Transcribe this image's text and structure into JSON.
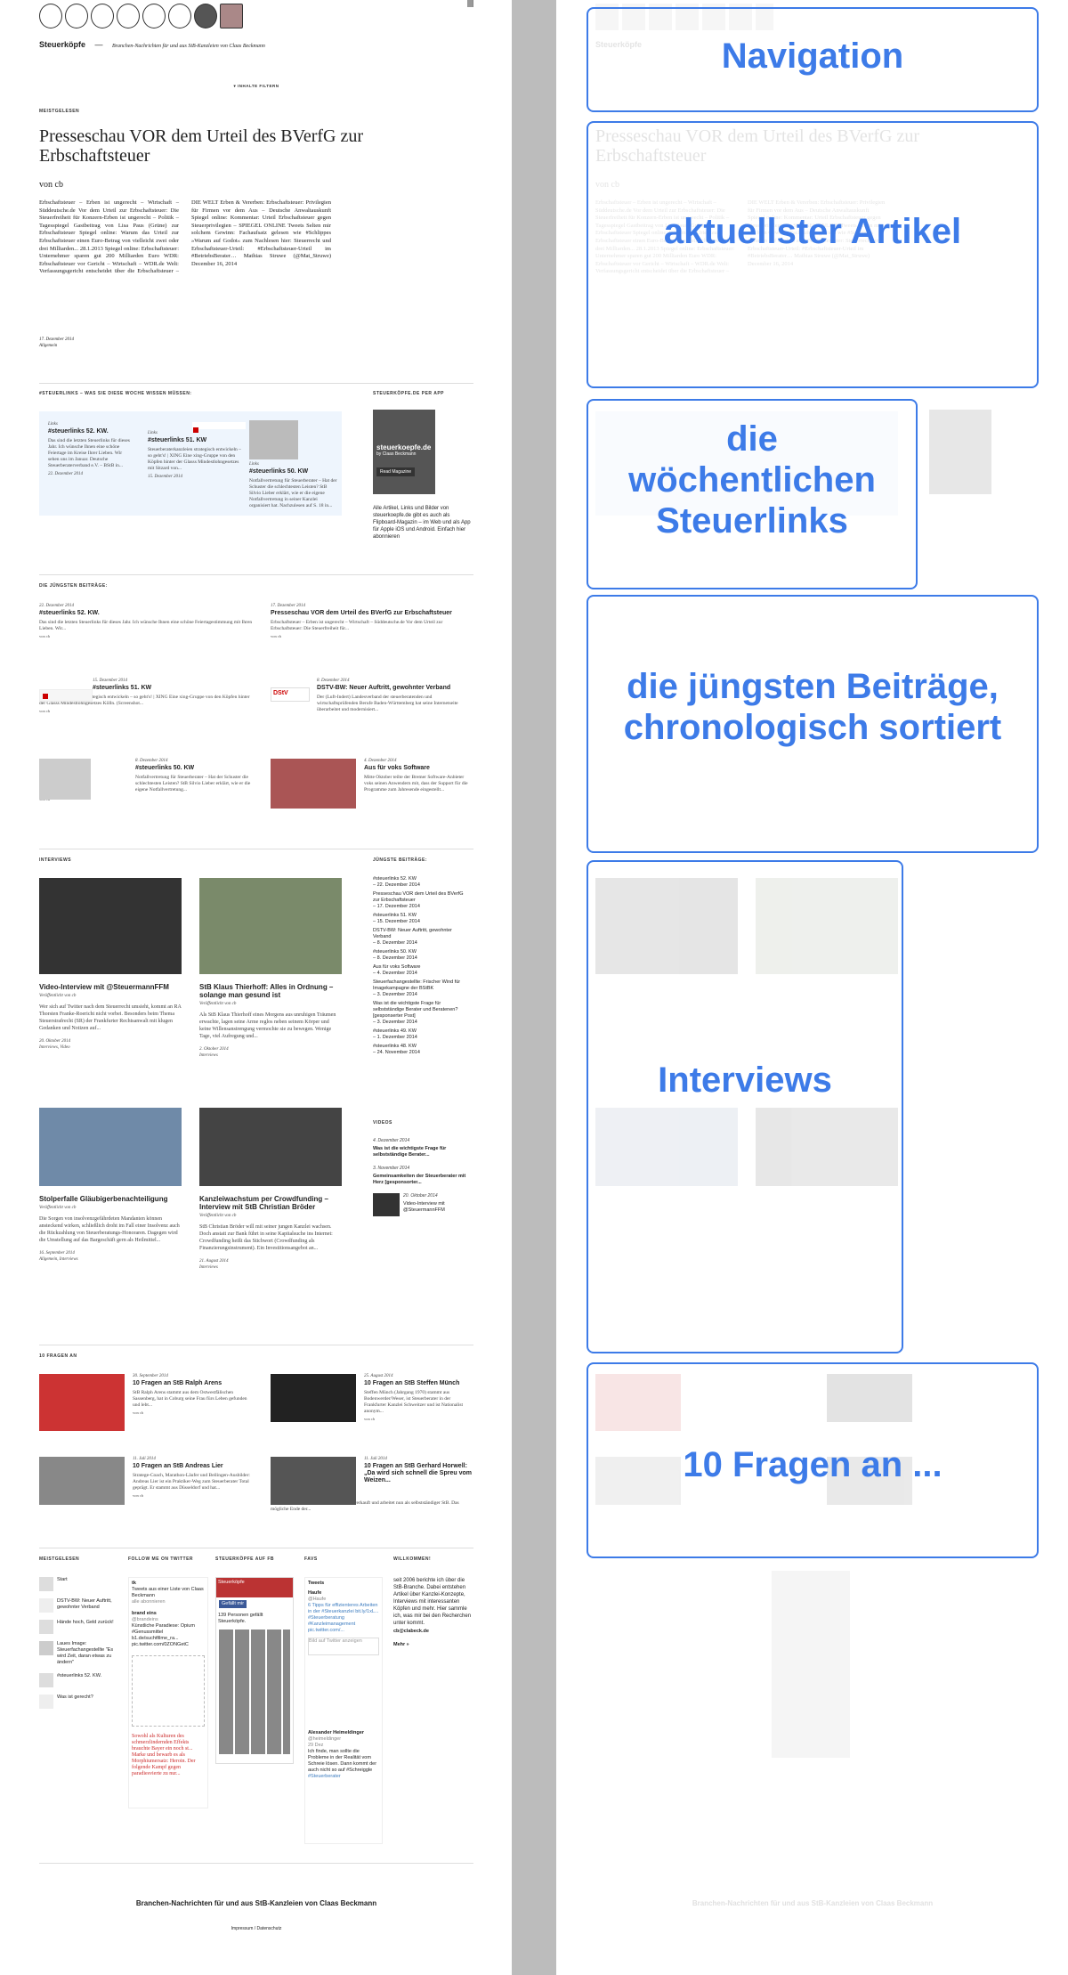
{
  "site": {
    "title": "Steuerköpfe",
    "separator": "—",
    "tagline": "Branchen-Nachrichten für und aus StB-Kanzleien von Claas Beckmann",
    "toc_label": "▾ INHALTE FILTERN"
  },
  "featured": {
    "section_label": "MEISTGELESEN",
    "title": "Presseschau VOR dem Urteil des BVerfG zur Erbschaftsteuer",
    "byline": "von cb",
    "body": "Erbschaftsteuer – Erben ist ungerecht – Wirtschaft – Süddeutsche.de Vor dem Urteil zur Erbschaftsteuer: Die Steuerfreiheit für Konzern-Erben ist ungerecht – Politik – Tagesspiegel Gastbeitrag von Lisa Paus (Grüne) zur Erbschaftsteuer Spiegel online: Warum das Urteil zur Erbschaftsteuer einen Euro-Betrag von vielleicht zwei oder drei Milliarden... 28.1.2013 Spiegel online: Erbschaftsteuer: Unternehmer sparen gut 200 Milliarden Euro WDR: Erbschaftsteuer vor Gericht – Wirtschaft – WDR.de Welt: Verfassungsgericht entscheidet über die Erbschaftsteuer – DIE WELT Erben & Vererben: Erbschaftsteuer: Privilegien für Firmen vor dem Aus – Deutsche Anwaltauskunft Spiegel online: Kommentar: Urteil Erbschaftsteuer gegen Steuerprivilegien – SPIEGEL ONLINE Tweets Selten mir solchem Gewinn: Fachaufsatz gelesen wie #Schlippes »Warum auf Godot« zum Nachlesen hier: Steuerrecht und Erbschaftsteuer-Urteil: #Erbschaftsteuer-Urteil im #BetriebsBerater… Mathias Struwe (@Mat_Struwe) December 16, 2014",
    "date": "17. Dezember 2014",
    "category": "Allgemein"
  },
  "steuerlinks": {
    "label": "#STEUERLINKS – WAS SIE DIESE WOCHE WISSEN MÜSSEN:",
    "items": [
      {
        "kicker": "Links",
        "title": "#steuerlinks 52. KW.",
        "text": "Das sind die letzten Steuerlinks für dieses Jahr. Ich wünsche Ihnen eine schöne Feiertage im Kreise Ihrer Lieben. Wir sehen uns im Januar. Deutsche Steuerberaterverband e.V. – BStB in...",
        "date": "22. Dezember 2014"
      },
      {
        "kicker": "Links",
        "title": "#steuerlinks 51. KW",
        "text": "Steuerberaterkanzleien strategisch entwickeln – so geht's! | XING Eine xing-Gruppe von den Köpfen hinter der Glasss Mindestlohngesetzes mit Sitzard von...",
        "date": "15. Dezember 2014"
      },
      {
        "kicker": "Links",
        "title": "#steuerlinks 50. KW",
        "text": "Notfallvertretung für Steuerberater – Hat der Schuster die schlechtesten Leisten? StB Silvio Lieber erklärt, wie er die eigene Notfallvertretung in seiner Kanzlei organisiert hat. Nachzulesen auf S. 18 in...",
        "date": ""
      }
    ]
  },
  "app": {
    "label": "STEUERKÖPFE.DE PER APP",
    "cover_title": "steuerkoepfe.de",
    "cover_sub": "by Claas Beckmann",
    "cover_button": "Read Magazine",
    "text": "Alle Artikel, Links und Bilder von steuerkoepfe.de gibt es auch als Flipboard-Magazin – im Web und als App für Apple iOS und Android. Einfach hier abonnieren"
  },
  "recent": {
    "label": "DIE JÜNGSTEN BEITRÄGE:",
    "items": [
      {
        "date": "22. Dezember 2014",
        "title": "#steuerlinks 52. KW.",
        "text": "Das sind die letzten Steuerlinks für dieses Jahr. Ich wünsche Ihnen eine schöne Feiertagestimmung mit Ihren Lieben. Wir...",
        "meta": "von cb"
      },
      {
        "date": "17. Dezember 2014",
        "title": "Presseschau VOR dem Urteil des BVerfG zur Erbschaftsteuer",
        "text": "Erbschaftsteuer – Erben ist ungerecht – Wirtschaft – Süddeutsche.de Vor dem Urteil zur Erbschaftsteuer: Die Steuerfreiheit für...",
        "meta": "von cb"
      },
      {
        "date": "15. Dezember 2014",
        "title": "#steuerlinks 51. KW",
        "text": "Steuerberaterkanzleien strategisch entwickeln – so geht's! | XING Eine xing-Gruppe von den Köpfen hinter der Glasss Mindestlohngesetzes Kölln. (Screenshot...",
        "meta": "von cb"
      },
      {
        "date": "8. Dezember 2014",
        "title": "DSTV-BW: Neuer Auftritt, gewohnter Verband",
        "text": "Der (Luft-Indert) Landesverband der steuerberatenden und wirtschaftsprüfenden Berufe Baden-Württemberg hat seine Internetseite überarbeitet und modernisiert...",
        "meta": "von cb"
      },
      {
        "date": "8. Dezember 2014",
        "title": "#steuerlinks 50. KW",
        "text": "Notfallvertretung für Steuerberater – Hat der Schuster die schlechtesten Leisten? StB Silvio Lieber erklärt, wie er die eigene Notfallvertretung...",
        "meta": "von cb"
      },
      {
        "date": "4. Dezember 2014",
        "title": "Aus für voks Software",
        "text": "Mitte Oktober teilte der Bremer Software-Anbieter voks seinen Anwendern mit, dass der Support für die Programme zum Jahresende eingestellt...",
        "meta": "von cb"
      }
    ]
  },
  "interviews": {
    "label": "INTERVIEWS",
    "items": [
      {
        "title": "Video-Interview mit @SteuermannFFM",
        "meta": "Veröffentlicht von cb",
        "text": "Wer sich auf Twitter nach dem Steuerrecht umsieht, kommt an RA Thorsten Franke-Roericht nicht vorbei. Besonders beim Thema Steuerstrafrecht (SR) der Frankfurter Rechtsanwalt mit klugen Gedanken und Notizen auf...",
        "date": "20. Oktober 2014",
        "cat": "Interviews, Video"
      },
      {
        "title": "StB Klaus Thierhoff: Alles in Ordnung – solange man gesund ist",
        "meta": "Veröffentlicht von cb",
        "text": "Als StB Klaus Thierhoff eines Morgens aus unruhigen Träumen erwachte, lagen seine Arme reglos neben seinem Körper und keine Willensanstrengung vermochte sie zu bewegen. Wenige Tage, viel Aufregung und...",
        "date": "2. Oktober 2014",
        "cat": "Interviews"
      },
      {
        "title": "Stolperfalle Gläubigerbenachteiligung",
        "meta": "Veröffentlicht von cb",
        "text": "Die Sorgen von insolvenzgefährdeten Mandanten können ansteckend wirken, schließlich droht im Fall einer Insolvenz auch die Rückzahlung von Steuerberatungs-Honoraren. Dagegen wird die Umstellung auf das Bargeschäft gern als Heilmittel...",
        "date": "16. September 2014",
        "cat": "Allgemein, Interviews"
      },
      {
        "title": "Kanzleiwachstum per Crowdfunding – Interview mit StB Christian Bröder",
        "meta": "Veröffentlicht von cb",
        "text": "StB Christian Bröder will mit seiner jungen Kanzlei wachsen. Doch anstatt zur Bank führt in seine Kapitalsuche ins Internet: Crowdfunding heißt das Stichwort (Crowdfunding als Finanzierungsinstrument). Ein Investitionsangebot an...",
        "date": "21. August 2014",
        "cat": "Interviews"
      }
    ]
  },
  "recent_list": {
    "label": "JÜNGSTE BEITRÄGE:",
    "items": [
      {
        "title": "#steuerlinks 52. KW",
        "date": "– 22. Dezember 2014"
      },
      {
        "title": "Presseschau VOR dem Urteil des BVerfG zur Erbschaftsteuer",
        "date": "– 17. Dezember 2014"
      },
      {
        "title": "#steuerlinks 51. KW",
        "date": "– 15. Dezember 2014"
      },
      {
        "title": "DSTV-BW: Neuer Auftritt, gewohnter Verband",
        "date": "– 8. Dezember 2014"
      },
      {
        "title": "#steuerlinks 50. KW",
        "date": "– 8. Dezember 2014"
      },
      {
        "title": "Aus für voks Software",
        "date": "– 4. Dezember 2014"
      },
      {
        "title": "Steuerfachangestellte: Frischer Wind für Imagekampagne der BStBK",
        "date": "– 3. Dezember 2014"
      },
      {
        "title": "Was ist die wichtigste Frage für selbstständige Berater und Beratenen? [gesponserter Post]",
        "date": "– 3. Dezember 2014"
      },
      {
        "title": "#steuerlinks 49. KW",
        "date": "– 1. Dezember 2014"
      },
      {
        "title": "#steuerlinks 48. KW",
        "date": "– 24. November 2014"
      }
    ]
  },
  "videos": {
    "label": "VIDEOS",
    "items": [
      {
        "date": "4. Dezember 2014",
        "title": "Was ist die wichtigste Frage für selbstständige Berater..."
      },
      {
        "date": "3. November 2014",
        "title": "Gemeinsamkeiten der Steuerberater mit Herz [gesponsorter..."
      },
      {
        "date": "20. Oktober 2014",
        "title": "Video-Interview mit @SteuermannFFM"
      }
    ]
  },
  "fragen": {
    "label": "10 FRAGEN AN",
    "items": [
      {
        "date": "30. September 2014",
        "title": "10 Fragen an StB Ralph Arens",
        "text": "StB Ralph Arens stammt aus dem Ostwestfälischen Sassenberg, hat in Coburg seine Frau fürs Leben gefunden und lebt...",
        "meta": "von cb"
      },
      {
        "date": "25. August 2014",
        "title": "10 Fragen an StB Steffen Münch",
        "text": "Steffen Münch (Jahrgang 1970) stammt aus Bodenwerder/Weser, ist Steuerberater in der Frankfurter Kanzlei Schweitzer und ist Nationalist anonym...",
        "meta": "von cb"
      },
      {
        "date": "11. Juli 2014",
        "title": "10 Fragen an StB Andreas Lier",
        "text": "Stratege-Coach, Marathon-Läufer und Beilingen-Ausbilder: Andreas Lier ist ein Praktiker-Weg zum Steuerberater Total geprägt. Er stammt aus Düsseldorf und hat...",
        "meta": "von cb"
      },
      {
        "date": "11. Juli 2014",
        "title": "10 Fragen an StB Gerhard Horwell: „Da wird sich schnell die Spreu vom Weizen...",
        "text": "Gerhard Horwell hat seine eigene Kanzlei verkauft und arbeitet nun als selbstständiger StB. Das mögliche Ende der...",
        "meta": "von cb"
      }
    ]
  },
  "footer_widgets": {
    "meistgelesen": {
      "label": "MEISTGELESEN",
      "items": [
        "Start",
        "DSTV-BW: Neuer Auftritt, gewohnter Verband",
        "Hände hoch, Geld zurück!",
        "Laues Image: Steuerfachangestellte \"Es wird Zeit, daran etwas zu ändern\"",
        "#steuerlinks 52. KW.",
        "Was ist gerecht?"
      ]
    },
    "twitter": {
      "label": "FOLLOW ME ON TWITTER",
      "name": "tk",
      "text": "Tweets aus einer Liste von Claas Beckmann",
      "sub": "alle abonnieren",
      "tweet_name": "brand eins",
      "tweet_handle": "@brandeins",
      "tweet_text": "Künstliche Paradiese: Opium #Genussmittel b1.de/suchtfilme_ra... pic.twitter.com/0ZONGetC",
      "art_text": "Sowohl als Kulturen des schmerzlindernden Effekts brauchte Bayer ein noch st... Marke und bewarb es als Morphiumersatz: Heroin. Der folgende Kampf gegen paradiesvierte zu nur..."
    },
    "fb": {
      "label": "STEUERKÖPFE AUF FB",
      "page": "Steuerköpfe",
      "button": "Gefällt mir",
      "count": "139 Personen gefällt Steuerköpfe."
    },
    "favs": {
      "label": "FAVS",
      "title": "Tweets",
      "t1_name": "Haufe",
      "t1_handle": "@Haufe",
      "t1_text": "6 Tipps für effizienteres Arbeiten in der #Steuerkanzlei bit.ly/1xL... #Steuerberatung #Kanzleimanagement pic.twitter.com/...",
      "input_placeholder": "Bild auf Twitter anzeigen",
      "t2_name": "Alexander Heimeldinger",
      "t2_handle": "@heimeldinger",
      "t2_date": "29 Dez",
      "t2_text": "Ich finde, man sollte die Probleme in der Realität vom Schreie lösen. Dann kommt der auch nicht so auf #Schreiggle",
      "t2_tag": "#Steuerberater"
    },
    "willkommen": {
      "label": "WILLKOMMEN!",
      "text": "seit 2006 berichte ich über die StB-Branche. Dabei entstehen Artikel über Kanzlei-Konzepte, Interviews mit interessanten Köpfen und mehr. Hier sammle ich, was mir bei den Recherchen unter kommt.",
      "email": "cb@clabeck.de",
      "more": "Mehr »"
    }
  },
  "footer": {
    "tagline": "Branchen-Nachrichten für und aus StB-Kanzleien von Claas Beckmann",
    "links": "Impressum / Datenschutz"
  },
  "overlays": {
    "navigation": "Navigation",
    "latest_article": "aktuellster Artikel",
    "weekly_links_1": "die",
    "weekly_links_2": "wöchentlichen",
    "weekly_links_3": "Steuerlinks",
    "recent_posts_1": "die jüngsten Beiträge,",
    "recent_posts_2": "chronologisch sortiert",
    "interviews": "Interviews",
    "ten_questions": "10 Fragen an ..."
  },
  "colors": {
    "overlay_border": "#3d7be8",
    "link_box_bg": "#eef5fd",
    "gutter": "#bcbcbc",
    "red": "#cc2a2a"
  }
}
